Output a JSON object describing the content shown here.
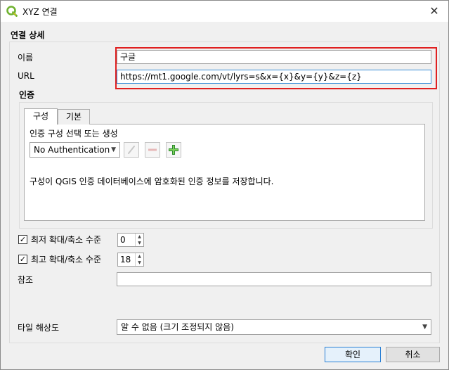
{
  "window": {
    "title": "XYZ 연결"
  },
  "details": {
    "section_title": "연결 상세",
    "name_label": "이름",
    "name_value": "구글",
    "url_label": "URL",
    "url_value": "https://mt1.google.com/vt/lyrs=s&x={x}&y={y}&z={z}"
  },
  "auth": {
    "section_title": "인증",
    "tabs": [
      {
        "label": "구성"
      },
      {
        "label": "기본"
      }
    ],
    "config_label": "인증 구성 선택 또는 생성",
    "config_value": "No Authentication",
    "info_text": "구성이 QGIS 인증 데이터베이스에 암호화된 인증 정보를 저장합니다."
  },
  "zoom": {
    "min_label": "최저 확대/축소 수준",
    "min_checked": true,
    "min_value": "0",
    "max_label": "최고 확대/축소 수준",
    "max_checked": true,
    "max_value": "18"
  },
  "referer": {
    "label": "참조",
    "value": ""
  },
  "tile": {
    "label": "타일 해상도",
    "value": "알 수 없음 (크기 조정되지 않음)"
  },
  "buttons": {
    "ok": "확인",
    "cancel": "취소"
  },
  "colors": {
    "highlight": "#e02020",
    "qgis_green": "#6fb230",
    "focus": "#3b8fd8"
  }
}
